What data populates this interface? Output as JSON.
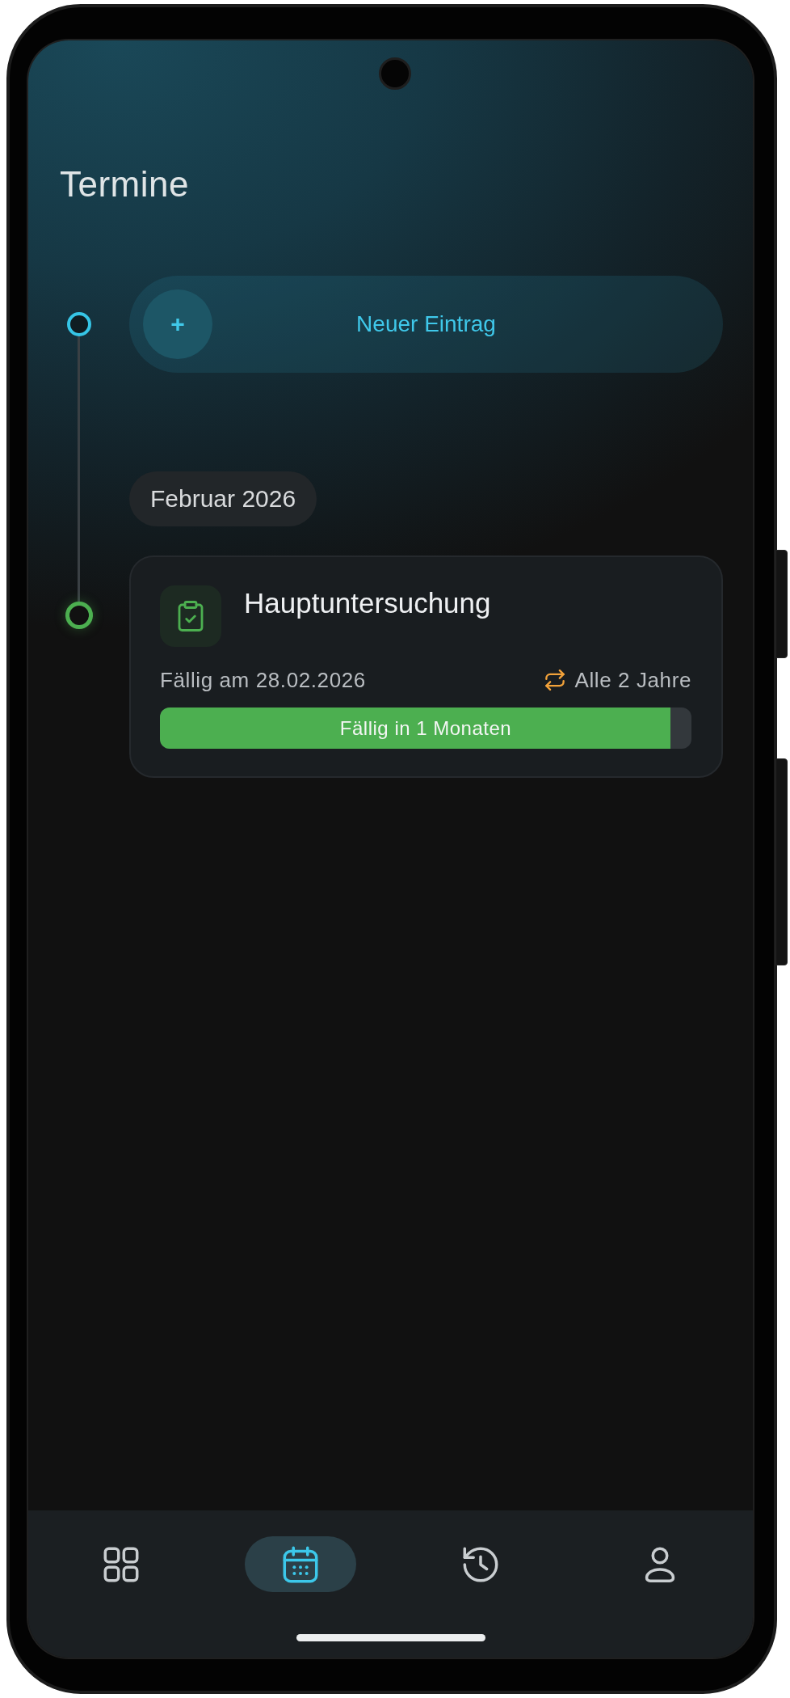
{
  "header": {
    "title": "Termine"
  },
  "timeline": {
    "new_entry_button": {
      "icon": "+",
      "label": "Neuer Eintrag"
    },
    "month_groups": [
      {
        "label": "Februar 2026",
        "entries": [
          {
            "title": "Hauptuntersuchung",
            "due": "Fällig am 28.02.2026",
            "interval": "Alle 2 Jahre",
            "progress": {
              "label": "Fällig in 1 Monaten",
              "level": 0.96
            }
          }
        ]
      }
    ]
  },
  "bottom_nav": {
    "items": [
      {
        "selected": false
      },
      {
        "selected": true
      },
      {
        "selected": false
      },
      {
        "selected": false
      }
    ]
  }
}
